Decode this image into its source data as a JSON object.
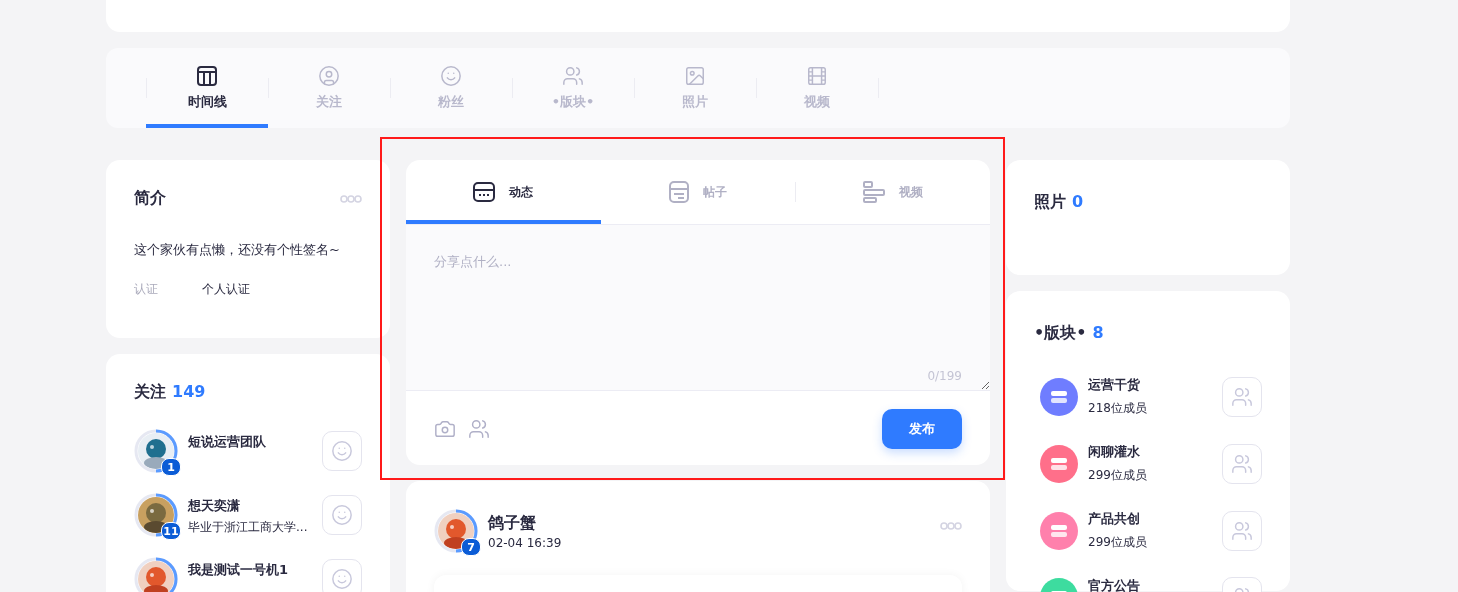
{
  "nav_tabs": [
    {
      "label": "时间线",
      "selected": true
    },
    {
      "label": "关注",
      "selected": false
    },
    {
      "label": "粉丝",
      "selected": false
    },
    {
      "label": "•版块•",
      "selected": false
    },
    {
      "label": "照片",
      "selected": false
    },
    {
      "label": "视频",
      "selected": false
    }
  ],
  "intro": {
    "title": "简介",
    "bio": "这个家伙有点懒，还没有个性签名~",
    "verify_label": "认证",
    "verify_value": "个人认证"
  },
  "following": {
    "title": "关注",
    "count": "149",
    "items": [
      {
        "name": "短说运营团队",
        "level": "1"
      },
      {
        "name": "想天奕潇",
        "subtitle": "毕业于浙江工商大学...",
        "level": "11"
      },
      {
        "name": "我是测试一号机1"
      }
    ]
  },
  "composer": {
    "tabs": [
      {
        "label": "动态",
        "selected": true
      },
      {
        "label": "帖子",
        "selected": false
      },
      {
        "label": "视频",
        "selected": false
      }
    ],
    "placeholder": "分享点什么...",
    "counter": "0/199",
    "submit": "发布"
  },
  "post": {
    "author": "鸽子蟹",
    "level": "7",
    "time": "02-04 16:39"
  },
  "photos": {
    "title": "照片",
    "count": "0"
  },
  "boards": {
    "title": "•版块•",
    "count": "8",
    "items": [
      {
        "name": "运营干货",
        "members": "218位成员",
        "color": "#6f7dff"
      },
      {
        "name": "闲聊灌水",
        "members": "299位成员",
        "color": "#ff6f8a"
      },
      {
        "name": "产品共创",
        "members": "299位成员",
        "color": "#ff80ac"
      },
      {
        "name": "官方公告",
        "color": "#3ddc9f"
      }
    ]
  }
}
